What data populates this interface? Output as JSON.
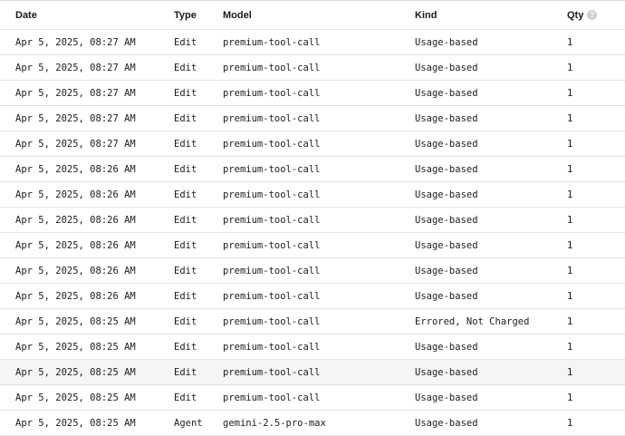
{
  "table": {
    "headers": {
      "date": "Date",
      "type": "Type",
      "model": "Model",
      "kind": "Kind",
      "qty": "Qty",
      "qty_help_icon": "?"
    },
    "rows": [
      {
        "date": "Apr 5, 2025, 08:27 AM",
        "type": "Edit",
        "model": "premium-tool-call",
        "kind": "Usage-based",
        "qty": "1"
      },
      {
        "date": "Apr 5, 2025, 08:27 AM",
        "type": "Edit",
        "model": "premium-tool-call",
        "kind": "Usage-based",
        "qty": "1"
      },
      {
        "date": "Apr 5, 2025, 08:27 AM",
        "type": "Edit",
        "model": "premium-tool-call",
        "kind": "Usage-based",
        "qty": "1"
      },
      {
        "date": "Apr 5, 2025, 08:27 AM",
        "type": "Edit",
        "model": "premium-tool-call",
        "kind": "Usage-based",
        "qty": "1"
      },
      {
        "date": "Apr 5, 2025, 08:27 AM",
        "type": "Edit",
        "model": "premium-tool-call",
        "kind": "Usage-based",
        "qty": "1"
      },
      {
        "date": "Apr 5, 2025, 08:26 AM",
        "type": "Edit",
        "model": "premium-tool-call",
        "kind": "Usage-based",
        "qty": "1"
      },
      {
        "date": "Apr 5, 2025, 08:26 AM",
        "type": "Edit",
        "model": "premium-tool-call",
        "kind": "Usage-based",
        "qty": "1"
      },
      {
        "date": "Apr 5, 2025, 08:26 AM",
        "type": "Edit",
        "model": "premium-tool-call",
        "kind": "Usage-based",
        "qty": "1"
      },
      {
        "date": "Apr 5, 2025, 08:26 AM",
        "type": "Edit",
        "model": "premium-tool-call",
        "kind": "Usage-based",
        "qty": "1"
      },
      {
        "date": "Apr 5, 2025, 08:26 AM",
        "type": "Edit",
        "model": "premium-tool-call",
        "kind": "Usage-based",
        "qty": "1"
      },
      {
        "date": "Apr 5, 2025, 08:26 AM",
        "type": "Edit",
        "model": "premium-tool-call",
        "kind": "Usage-based",
        "qty": "1"
      },
      {
        "date": "Apr 5, 2025, 08:25 AM",
        "type": "Edit",
        "model": "premium-tool-call",
        "kind": "Errored, Not Charged",
        "qty": "1"
      },
      {
        "date": "Apr 5, 2025, 08:25 AM",
        "type": "Edit",
        "model": "premium-tool-call",
        "kind": "Usage-based",
        "qty": "1"
      },
      {
        "date": "Apr 5, 2025, 08:25 AM",
        "type": "Edit",
        "model": "premium-tool-call",
        "kind": "Usage-based",
        "qty": "1"
      },
      {
        "date": "Apr 5, 2025, 08:25 AM",
        "type": "Edit",
        "model": "premium-tool-call",
        "kind": "Usage-based",
        "qty": "1"
      },
      {
        "date": "Apr 5, 2025, 08:25 AM",
        "type": "Agent",
        "model": "gemini-2.5-pro-max",
        "kind": "Usage-based",
        "qty": "1"
      }
    ]
  }
}
